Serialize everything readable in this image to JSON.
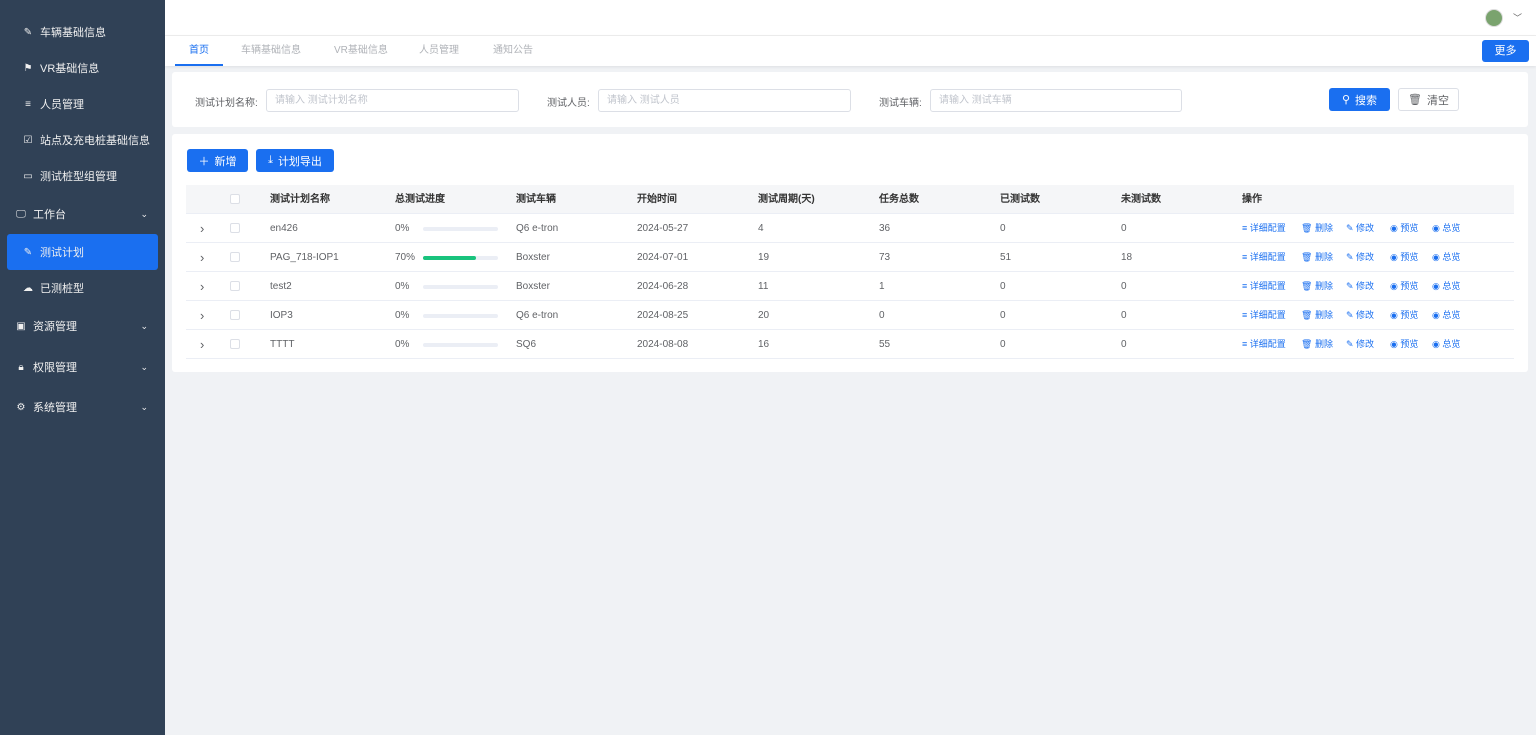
{
  "sidebar": {
    "items": [
      {
        "label": "车辆基础信息",
        "icon": "edit-icon"
      },
      {
        "label": "VR基础信息",
        "icon": "flag-icon"
      },
      {
        "label": "人员管理",
        "icon": "list-icon"
      },
      {
        "label": "站点及充电桩基础信息",
        "icon": "checkbox-icon"
      },
      {
        "label": "测试桩型组管理",
        "icon": "monitor-icon"
      },
      {
        "label": "工作台",
        "icon": "desktop-icon"
      },
      {
        "label": "测试计划",
        "icon": "edit-icon",
        "active": true
      },
      {
        "label": "已测桩型",
        "icon": "cloud-icon"
      },
      {
        "label": "资源管理",
        "icon": "folder-icon"
      },
      {
        "label": "权限管理",
        "icon": "lock-icon"
      },
      {
        "label": "系统管理",
        "icon": "gear-icon"
      }
    ]
  },
  "tabs": [
    "首页",
    "车辆基础信息",
    "VR基础信息",
    "人员管理",
    "通知公告"
  ],
  "more_label": "更多",
  "search": {
    "plan_label": "测试计划名称:",
    "plan_placeholder": "请输入 测试计划名称",
    "person_label": "测试人员:",
    "person_placeholder": "请输入 测试人员",
    "vehicle_label": "测试车辆:",
    "vehicle_placeholder": "请输入 测试车辆",
    "search_label": "搜索",
    "clear_label": "清空"
  },
  "toolbar": {
    "add_label": "新增",
    "export_label": "计划导出"
  },
  "table": {
    "headers": [
      "测试计划名称",
      "总测试进度",
      "测试车辆",
      "开始时间",
      "测试周期(天)",
      "任务总数",
      "已测试数",
      "未测试数",
      "操作"
    ],
    "ops": [
      "详细配置",
      "删除",
      "修改",
      "预览",
      "总览"
    ],
    "rows": [
      {
        "name": "en426",
        "progress": "0%",
        "progress_value": 0,
        "vehicle": "Q6 e-tron",
        "start": "2024-05-27",
        "period": "4",
        "total": "36",
        "tested": "0",
        "untested": "0"
      },
      {
        "name": "PAG_718-IOP1",
        "progress": "70%",
        "progress_value": 70,
        "vehicle": "Boxster",
        "start": "2024-07-01",
        "period": "19",
        "total": "73",
        "tested": "51",
        "untested": "18"
      },
      {
        "name": "test2",
        "progress": "0%",
        "progress_value": 0,
        "vehicle": "Boxster",
        "start": "2024-06-28",
        "period": "11",
        "total": "1",
        "tested": "0",
        "untested": "0"
      },
      {
        "name": "IOP3",
        "progress": "0%",
        "progress_value": 0,
        "vehicle": "Q6 e-tron",
        "start": "2024-08-25",
        "period": "20",
        "total": "0",
        "tested": "0",
        "untested": "0"
      },
      {
        "name": "TTTT",
        "progress": "0%",
        "progress_value": 0,
        "vehicle": "SQ6",
        "start": "2024-08-08",
        "period": "16",
        "total": "55",
        "tested": "0",
        "untested": "0"
      }
    ]
  },
  "colors": {
    "sidebar": "#304156",
    "primary": "#1a6ff0",
    "progress": "#19c37d"
  }
}
